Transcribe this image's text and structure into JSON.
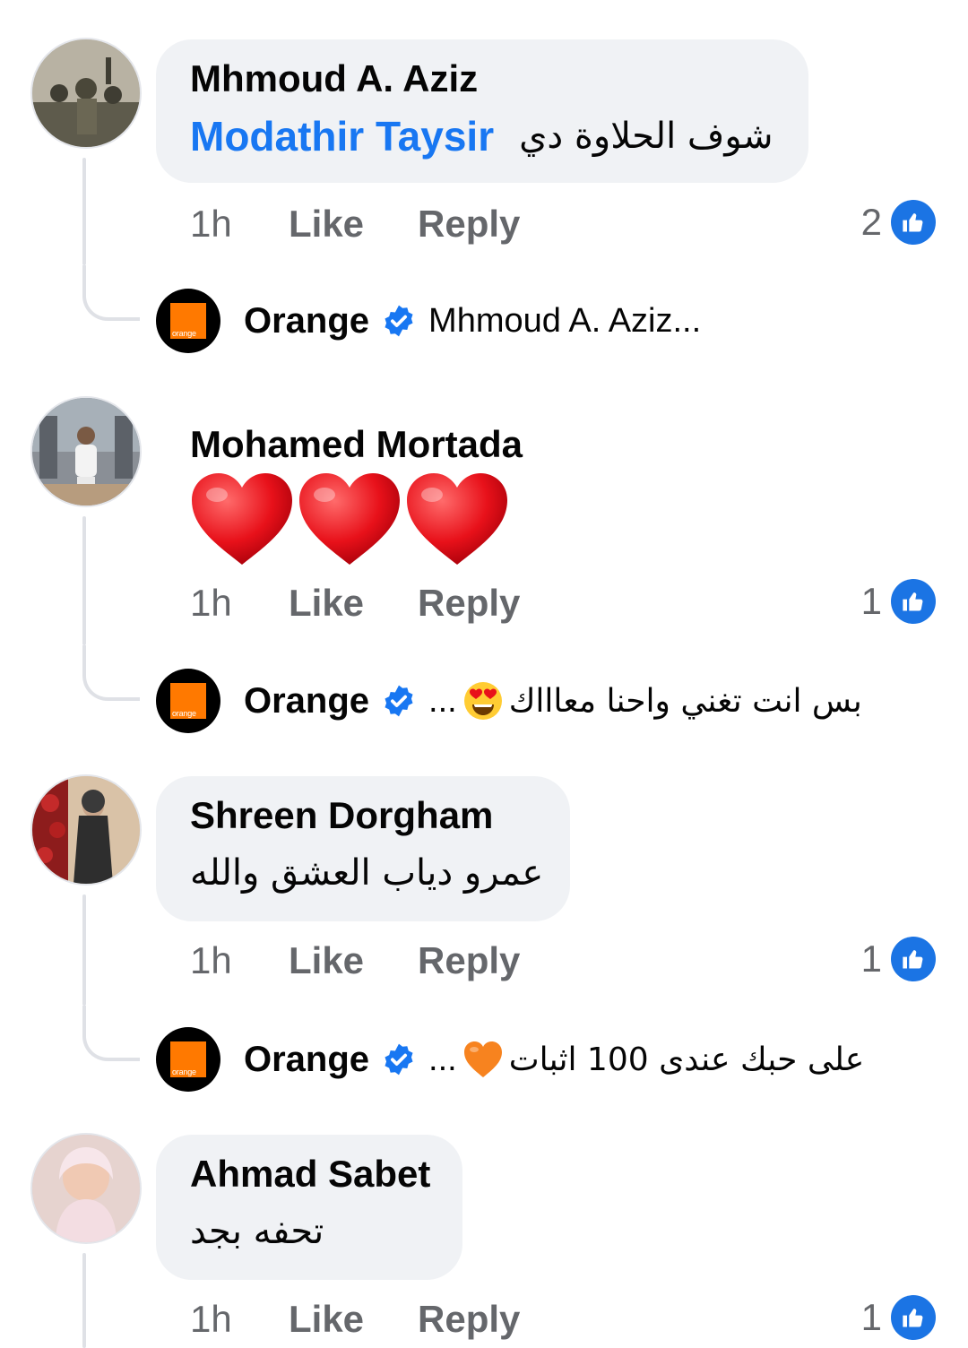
{
  "comments": [
    {
      "author": "Mhmoud A. Aziz",
      "mention": "Modathir Taysir",
      "text": "شوف الحلاوة دي",
      "time": "1h",
      "like_label": "Like",
      "reply_label": "Reply",
      "reaction_count": "2",
      "reaction_icon": "like-icon",
      "reply": {
        "author": "Orange",
        "verified": true,
        "snippet": "Mhmoud A. Aziz..."
      }
    },
    {
      "author": "Mohamed Mortada",
      "emoji": [
        "red-heart",
        "red-heart",
        "red-heart"
      ],
      "time": "1h",
      "like_label": "Like",
      "reply_label": "Reply",
      "reaction_count": "1",
      "reaction_icon": "like-icon",
      "reply": {
        "author": "Orange",
        "verified": true,
        "snippet_text": "بس انت تغني واحنا معاااك",
        "snippet_emoji": "heart-eyes-face",
        "snippet_ellipsis": "..."
      }
    },
    {
      "author": "Shreen Dorgham",
      "text": "عمرو دياب العشق والله",
      "time": "1h",
      "like_label": "Like",
      "reply_label": "Reply",
      "reaction_count": "1",
      "reaction_icon": "like-icon",
      "reply": {
        "author": "Orange",
        "verified": true,
        "snippet_text": "على حبك عندى 100 اثبات",
        "snippet_emoji": "orange-heart",
        "snippet_ellipsis": "..."
      }
    },
    {
      "author": "Ahmad Sabet",
      "text": "تحفه بجد",
      "time": "1h",
      "like_label": "Like",
      "reply_label": "Reply",
      "reaction_count": "1",
      "reaction_icon": "like-icon"
    }
  ],
  "brand": {
    "orange_logo_text": "orange",
    "orange_color": "#ff7900",
    "link_color": "#1877f2",
    "like_color": "#1b74e4"
  }
}
